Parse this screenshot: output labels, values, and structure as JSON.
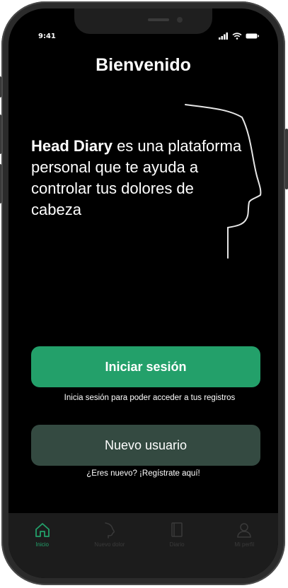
{
  "status_bar": {
    "time": "9:41"
  },
  "header": {
    "title": "Bienvenido"
  },
  "intro": {
    "brand": "Head Diary",
    "text": " es una plataforma personal que te ayuda a controlar tus dolores de cabeza"
  },
  "actions": {
    "login_label": "Iniciar sesión",
    "login_hint": "Inicia sesión para poder acceder a tus registros",
    "new_user_label": "Nuevo usuario",
    "new_user_hint": "¿Eres nuevo? ¡Regístrate aquí!"
  },
  "tabbar": {
    "items": [
      {
        "label": "Inicio",
        "icon": "home-icon",
        "active": true
      },
      {
        "label": "Nuevo dolor",
        "icon": "head-profile-icon",
        "active": false
      },
      {
        "label": "Diario",
        "icon": "diary-icon",
        "active": false
      },
      {
        "label": "Mi perfil",
        "icon": "user-icon",
        "active": false
      }
    ]
  },
  "colors": {
    "accent": "#23a06a",
    "secondary_button": "#344a41",
    "background": "#000000",
    "tabbar": "#1c1c1c"
  }
}
